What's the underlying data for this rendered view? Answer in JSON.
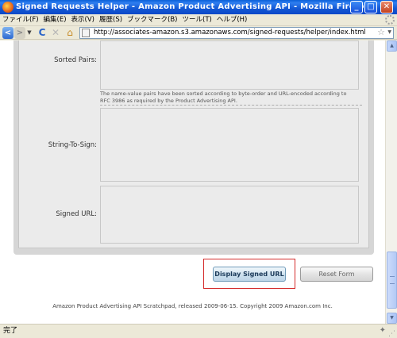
{
  "window": {
    "title": "Signed Requests Helper - Amazon Product Advertising API - Mozilla Firefox",
    "minimize_glyph": "_",
    "maximize_glyph": "□",
    "close_glyph": "✕"
  },
  "menu": [
    "ファイル(F)",
    "編集(E)",
    "表示(V)",
    "履歴(S)",
    "ブックマーク(B)",
    "ツール(T)",
    "ヘルプ(H)"
  ],
  "nav": {
    "back_glyph": "<",
    "forward_glyph": ">",
    "dropdown_glyph": "▼",
    "reload_glyph": "C",
    "stop_glyph": "✕",
    "home_glyph": "⌂",
    "url": "http://associates-amazon.s3.amazonaws.com/signed-requests/helper/index.html",
    "star_glyph": "☆"
  },
  "form": {
    "sorted_pairs_label": "Sorted Pairs:",
    "sorted_pairs_note": "The name-value pairs have been sorted according to byte-order and URL-encoded according to RFC 3986 as required by the Product Advertising API.",
    "string_to_sign_label": "String-To-Sign:",
    "signed_url_label": "Signed URL:",
    "sorted_pairs_value": "",
    "string_to_sign_value": "",
    "signed_url_value": ""
  },
  "buttons": {
    "display_signed_url": "Display Signed URL",
    "reset_form": "Reset Form"
  },
  "footer": "Amazon Product Advertising API Scratchpad, released 2009-06-15. Copyright 2009 Amazon.com Inc.",
  "status": {
    "text": "完了"
  },
  "colors": {
    "titlebar": "#1458d4",
    "highlight": "#d42a2a"
  }
}
